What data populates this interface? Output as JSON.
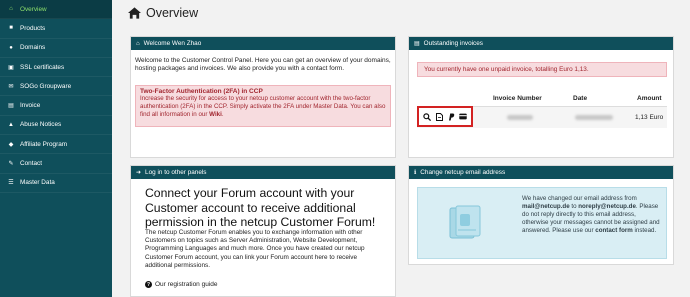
{
  "sidebar": {
    "items": [
      {
        "label": "Overview",
        "icon": "home-icon",
        "active": true
      },
      {
        "label": "Products",
        "icon": "box-icon"
      },
      {
        "label": "Domains",
        "icon": "globe-icon"
      },
      {
        "label": "SSL certificates",
        "icon": "lock-icon"
      },
      {
        "label": "SOGo Groupware",
        "icon": "mail-icon"
      },
      {
        "label": "Invoice",
        "icon": "invoice-icon"
      },
      {
        "label": "Abuse Notices",
        "icon": "warning-icon"
      },
      {
        "label": "Affiliate Program",
        "icon": "affiliate-icon"
      },
      {
        "label": "Contact",
        "icon": "contact-icon"
      },
      {
        "label": "Master Data",
        "icon": "user-icon"
      }
    ]
  },
  "page": {
    "title": "Overview"
  },
  "welcome": {
    "header": "Welcome Wen Zhao",
    "body": "Welcome to the Customer Control Panel. Here you can get an overview of your domains, hosting packages and invoices. We also provide you with a contact form.",
    "alert_title": "Two-Factor Authentication (2FA) in CCP",
    "alert_body": "Increase the security for access to your netcup customer account with the two-factor authentication (2FA) in the CCP. Simply activate the 2FA under Master Data. You can also find all information in our",
    "alert_link": "Wiki",
    "alert_end": "."
  },
  "invoices": {
    "header": "Outstanding invoices",
    "notice": "You currently have one unpaid invoice, totalling Euro 1,13.",
    "columns": {
      "number": "Invoice Number",
      "date": "Date",
      "amount": "Amount"
    },
    "rows": [
      {
        "amount": "1,13 Euro",
        "actions": [
          "search-icon",
          "pdf-icon",
          "paypal-icon",
          "card-icon"
        ]
      }
    ]
  },
  "forum": {
    "header": "Log in to other panels",
    "headline": "Connect your Forum account with your Customer account to receive additional permission in the netcup Customer Forum!",
    "body": "The netcup Customer Forum enables you to exchange information with other Customers on topics such as Server Administration, Website Development, Programming Languages and much more. Once you have created our netcup Customer Forum account, you can link your Forum account here to receive additional permissions.",
    "guide": "Our registration guide"
  },
  "email_change": {
    "header": "Change netcup email address",
    "text1": "We have changed our email address from",
    "old_email": "mail@netcup.de",
    "text2": "to",
    "new_email": "noreply@netcup.de",
    "text3": ". Please do not reply directly to this email address, otherwise your messages cannot be assigned and answered. Please use our",
    "contact_link": "contact form",
    "text4": "instead."
  },
  "colors": {
    "primary": "#0f4f5b",
    "active_text": "#8ee06b",
    "alert_bg": "#f7dcdf",
    "alert_text": "#a1262f",
    "highlight": "#d32222"
  }
}
